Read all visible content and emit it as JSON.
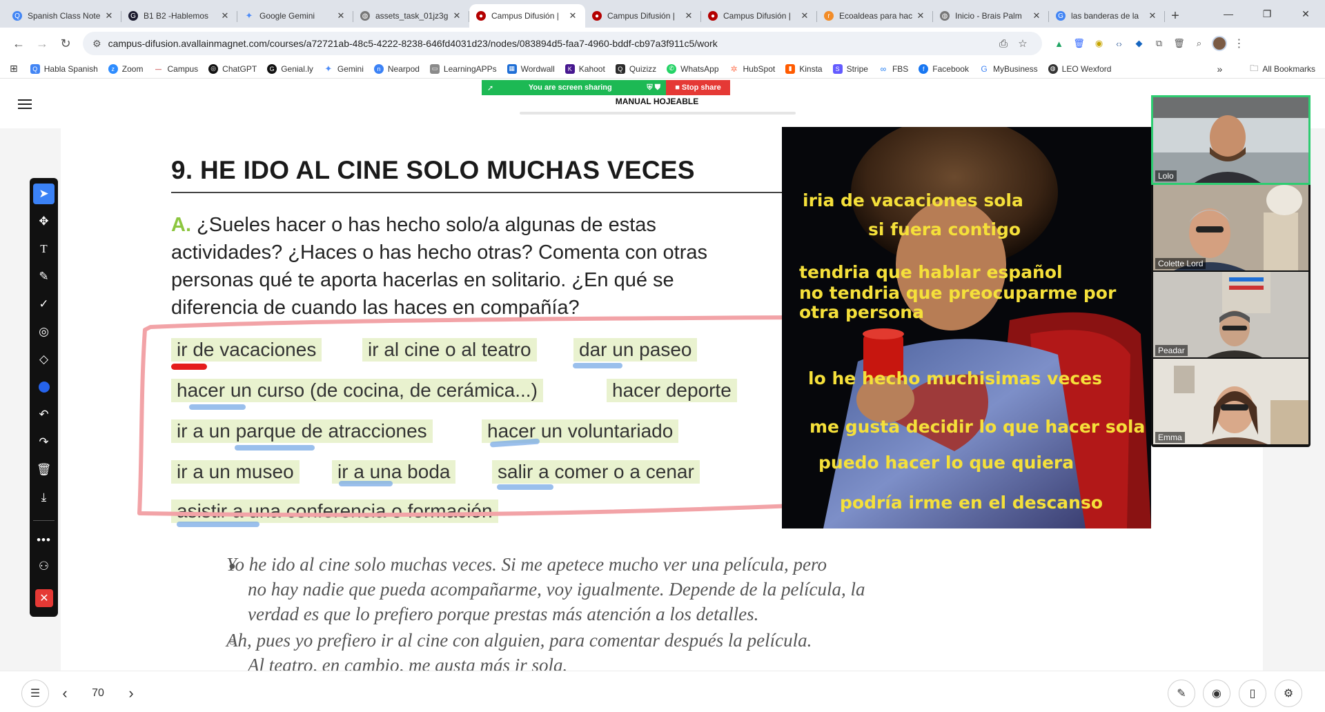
{
  "browser": {
    "tabs": [
      {
        "label": "Spanish Class Note",
        "icon_color": "#4285f4",
        "glyph": "Q"
      },
      {
        "label": "B1 B2 -Hablemos",
        "icon_color": "#1a1a2e",
        "glyph": "G"
      },
      {
        "label": "Google Gemini",
        "icon_color": "#4e8cf7",
        "glyph": "✦"
      },
      {
        "label": "assets_task_01jz3g",
        "icon_color": "#555555",
        "glyph": "◍"
      },
      {
        "label": "Campus Difusión |",
        "icon_color": "#b40000",
        "glyph": "●"
      },
      {
        "label": "Campus Difusión |",
        "icon_color": "#b40000",
        "glyph": "●"
      },
      {
        "label": "Campus Difusión |",
        "icon_color": "#b40000",
        "glyph": "●"
      },
      {
        "label": "Ecoaldeas para hac",
        "icon_color": "#f28c28",
        "glyph": "r"
      },
      {
        "label": "Inicio - Brais Palm",
        "icon_color": "#666666",
        "glyph": "◍"
      },
      {
        "label": "las banderas de la",
        "icon_color": "#4285f4",
        "glyph": "G"
      }
    ],
    "active_tab_index": 4,
    "url": "campus-difusion.avallainmagnet.com/courses/a72721ab-48c5-4222-8238-646fd4031d23/nodes/083894d5-faa7-4960-bddf-cb97a3f911c5/work",
    "bookmarks": [
      {
        "label": "Habla Spanish",
        "color": "#4285f4",
        "glyph": "Q"
      },
      {
        "label": "Zoom",
        "color": "#2d8cff",
        "glyph": "zm"
      },
      {
        "label": "Campus",
        "color": "#b40000",
        "glyph": "—"
      },
      {
        "label": "ChatGPT",
        "color": "#111111",
        "glyph": "◎"
      },
      {
        "label": "Genial.ly",
        "color": "#111111",
        "glyph": "G"
      },
      {
        "label": "Gemini",
        "color": "#4e8cf7",
        "glyph": "✦"
      },
      {
        "label": "Nearpod",
        "color": "#3b82f6",
        "glyph": "n"
      },
      {
        "label": "LearningAPPs",
        "color": "#8a8a8a",
        "glyph": "▭"
      },
      {
        "label": "Wordwall",
        "color": "#1f6fd6",
        "glyph": "▦"
      },
      {
        "label": "Kahoot",
        "color": "#46178f",
        "glyph": "K"
      },
      {
        "label": "Quizizz",
        "color": "#2b2b2b",
        "glyph": "Q"
      },
      {
        "label": "WhatsApp",
        "color": "#25d366",
        "glyph": "✆"
      },
      {
        "label": "HubSpot",
        "color": "#ff7a59",
        "glyph": "✲"
      },
      {
        "label": "Kinsta",
        "color": "#ff5b00",
        "glyph": "▮"
      },
      {
        "label": "Stripe",
        "color": "#635bff",
        "glyph": "S"
      },
      {
        "label": "FBS",
        "color": "#1877f2",
        "glyph": "∞"
      },
      {
        "label": "Facebook",
        "color": "#1877f2",
        "glyph": "f"
      },
      {
        "label": "MyBusiness",
        "color": "#4285f4",
        "glyph": "G"
      },
      {
        "label": "LEO Wexford",
        "color": "#333333",
        "glyph": "◍"
      }
    ],
    "all_bookmarks": "All Bookmarks"
  },
  "app": {
    "share_banner": "You are screen sharing",
    "stop_share": "Stop share",
    "manual_title": "MANUAL HOJEABLE",
    "current_page": "70"
  },
  "exercise": {
    "title": "9.  HE IDO AL CINE SOLO MUCHAS VECES",
    "prompt_letter": "A.",
    "prompt_text": " ¿Sueles hacer o has hecho solo/a algunas de estas actividades? ¿Haces o has hecho otras? Comenta con otras personas qué te aporta hacerlas en solitario. ¿En qué se diferencia de cuando las haces en compañía?",
    "activities": [
      "ir de vacaciones",
      "ir al cine o al teatro",
      "dar un paseo",
      "hacer un curso (de cocina, de cerámica...)",
      "hacer deporte",
      "ir a un parque de atracciones",
      "hacer un voluntariado",
      "ir a un museo",
      "ir a una boda",
      "salir a comer o a cenar",
      "asistir a una conferencia o formación"
    ],
    "quotes": [
      "Yo he ido al cine solo muchas veces. Si me apetece mucho ver una película, pero",
      "no hay nadie que pueda acompañarme, voy igualmente. Depende de la película, la",
      "verdad es que lo prefiero porque prestas más atención a los detalles.",
      "Ah, pues yo prefiero ir al cine con alguien, para comentar después la película.",
      "Al teatro, en cambio, me gusta más ir sola."
    ]
  },
  "overlay_notes": [
    "iria de vacaciones sola",
    "si fuera contigo",
    "tendria que hablar español",
    "no tendria que preocuparme por",
    "otra persona",
    "lo he hecho muchisimas veces",
    "me gusta decidir lo que hacer sola",
    "puedo hacer lo que quiera",
    "podría irme en el descanso"
  ],
  "participants": [
    {
      "name": "Lolo",
      "speaking": true
    },
    {
      "name": "Colette Lord",
      "speaking": false
    },
    {
      "name": "Peadar",
      "speaking": false
    },
    {
      "name": "Emma",
      "speaking": false
    }
  ],
  "colors": {
    "highlight_chip": "#e9f2cf",
    "annotation_box": "#f2a3a7",
    "overlay_text": "#f5e03a",
    "accent_green": "#8cc63f",
    "share_green": "#1db954",
    "stop_red": "#e53935"
  }
}
